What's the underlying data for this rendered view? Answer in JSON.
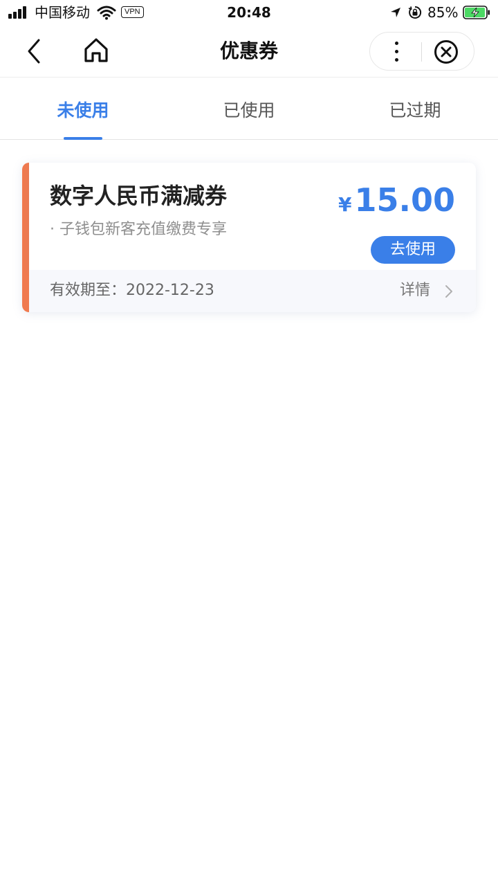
{
  "status_bar": {
    "carrier": "中国移动",
    "vpn": "VPN",
    "time": "20:48",
    "battery_percent": "85%",
    "icons": [
      "signal-icon",
      "wifi-icon",
      "location-arrow-icon",
      "orientation-lock-icon",
      "battery-charging-icon"
    ]
  },
  "nav": {
    "title": "优惠券",
    "icons": [
      "back-icon",
      "home-icon",
      "more-icon",
      "close-icon"
    ]
  },
  "tabs": [
    {
      "label": "未使用",
      "active": true
    },
    {
      "label": "已使用",
      "active": false
    },
    {
      "label": "已过期",
      "active": false
    }
  ],
  "coupon": {
    "title": "数字人民币满减券",
    "description": "· 子钱包新客充值缴费专享",
    "currency": "¥",
    "amount": "15.00",
    "use_label": "去使用",
    "validity": "有效期至：2022-12-23",
    "detail_label": "详情"
  },
  "colors": {
    "accent": "#3a7fe8",
    "coupon_stripe": "#f07a4f",
    "battery_fill": "#4cd964"
  }
}
